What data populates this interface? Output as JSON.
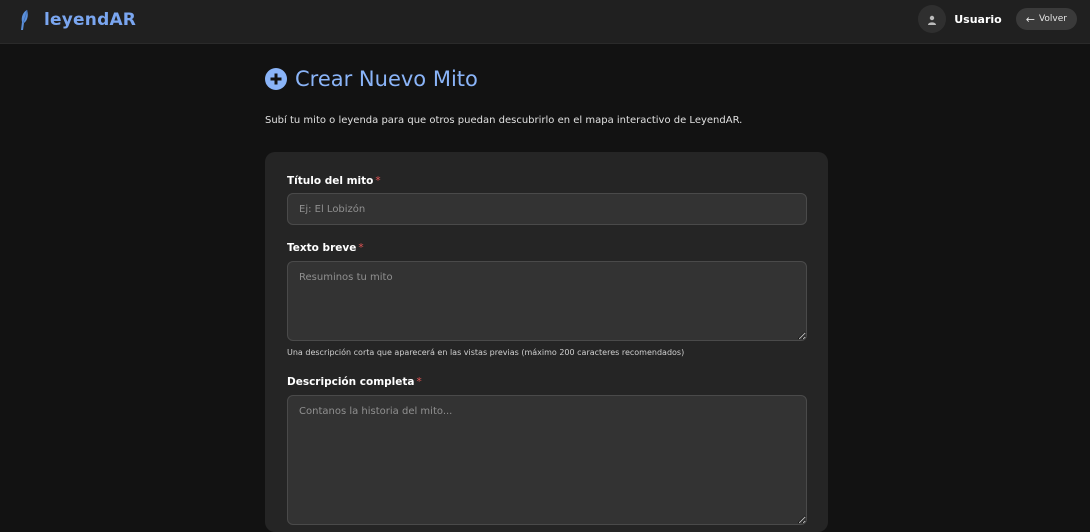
{
  "header": {
    "brand": "leyendAR",
    "user_name": "Usuario",
    "back_label": "Volver",
    "back_arrow": "←"
  },
  "page": {
    "title": "Crear Nuevo Mito",
    "subtitle": "Subí tu mito o leyenda para que otros puedan descubrirlo en el mapa interactivo de LeyendAR."
  },
  "form": {
    "title_field": {
      "label": "Título del mito",
      "required_mark": "*",
      "placeholder": "Ej: El Lobizón"
    },
    "short_text_field": {
      "label": "Texto breve",
      "required_mark": "*",
      "placeholder": "Resuminos tu mito",
      "help": "Una descripción corta que aparecerá en las vistas previas (máximo 200 caracteres recomendados)"
    },
    "description_field": {
      "label": "Descripción completa",
      "required_mark": "*",
      "placeholder": "Contanos la historia del mito..."
    }
  },
  "colors": {
    "accent": "#8ab4f8",
    "brand": "#7aa6f0",
    "required": "#e05555",
    "background": "#121212",
    "card": "#252525"
  },
  "icons": [
    "feather-logo-icon",
    "user-icon",
    "arrow-left-icon",
    "plus-circle-icon"
  ]
}
